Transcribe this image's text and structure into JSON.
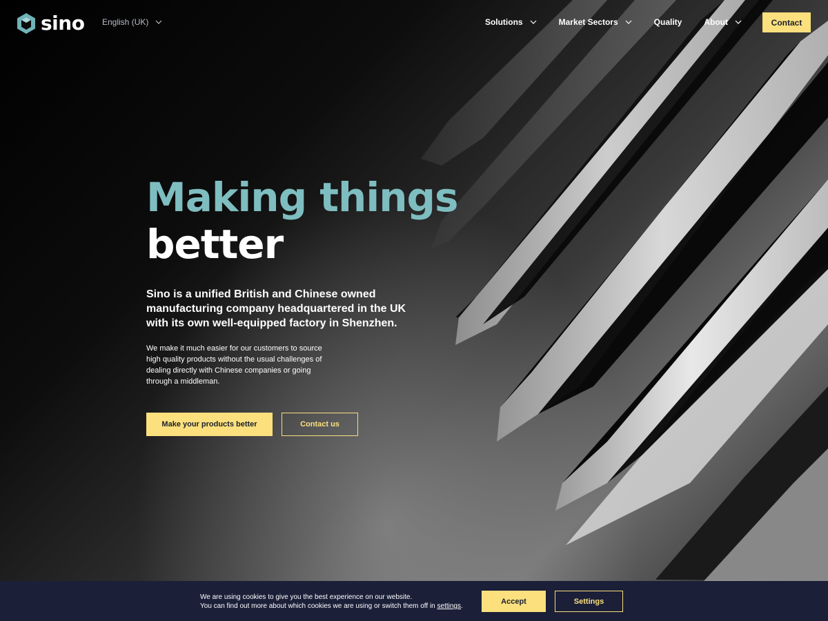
{
  "brand": {
    "name": "sino"
  },
  "header": {
    "language": "English (UK)",
    "nav": [
      {
        "label": "Solutions",
        "has_dropdown": true
      },
      {
        "label": "Market Sectors",
        "has_dropdown": true
      },
      {
        "label": "Quality",
        "has_dropdown": false
      },
      {
        "label": "About",
        "has_dropdown": true
      }
    ],
    "contact_label": "Contact"
  },
  "hero": {
    "headline_line1": "Making things",
    "headline_line2": "better",
    "lead": "Sino is a unified British and Chinese owned manufacturing company headquartered in the UK with its own well-equipped factory in Shenzhen.",
    "body": "We make it much easier for our customers to source high quality products without the usual challenges of dealing directly with Chinese companies or going through a middleman.",
    "primary_cta": "Make your products better",
    "secondary_cta": "Contact us"
  },
  "cookie_bar": {
    "line1": "We are using cookies to give you the best experience on our website.",
    "line2_prefix": "You can find out more about which cookies we are using or switch them off in ",
    "line2_link": "settings",
    "line2_suffix": ".",
    "accept_label": "Accept",
    "settings_label": "Settings"
  },
  "colors": {
    "accent_yellow": "#fbe07d",
    "headline_teal": "#7ebdc0",
    "cookie_bg": "#1b1f38",
    "logo_teal": "#6fb3b7"
  }
}
